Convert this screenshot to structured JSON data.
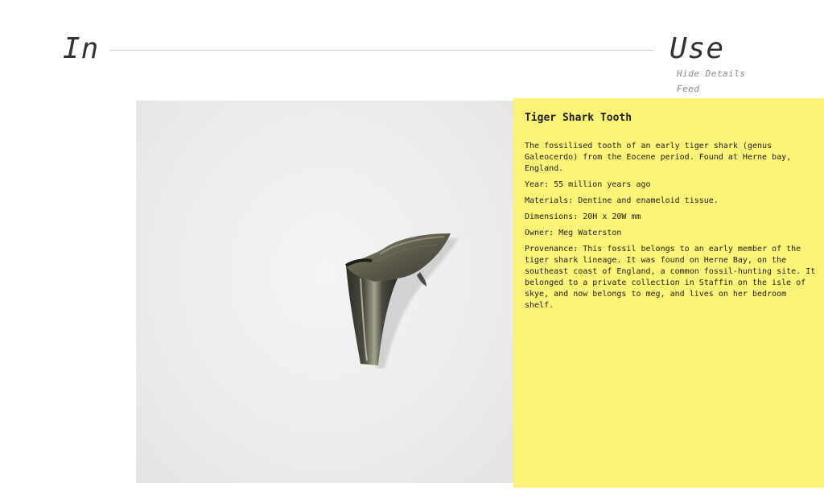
{
  "header": {
    "brand_left": "In",
    "brand_right": "Use"
  },
  "nav": {
    "hide_details": "Hide Details",
    "feed": "Feed"
  },
  "item": {
    "title": "Tiger Shark Tooth",
    "description": "The fossilised tooth of an early tiger shark (genus Galeocerdo) from the Eocene period. Found at Herne bay, England.",
    "year": "Year: 55 million years ago",
    "materials": "Materials: Dentine and enameloid tissue.",
    "dimensions": "Dimensions: 20H x 20W mm",
    "owner": "Owner: Meg Waterston",
    "provenance": "Provenance: This fossil belongs to an early member of the tiger shark lineage. It was found on Herne Bay, on the southeast coast of England, a common fossil-hunting site. It belonged to a private collection in Staffin on the isle of skye, and now belongs to meg, and lives on her bedroom shelf."
  },
  "colors": {
    "panel": "#fcf050",
    "background": "#ffffff",
    "photo_background": "#ececea"
  }
}
